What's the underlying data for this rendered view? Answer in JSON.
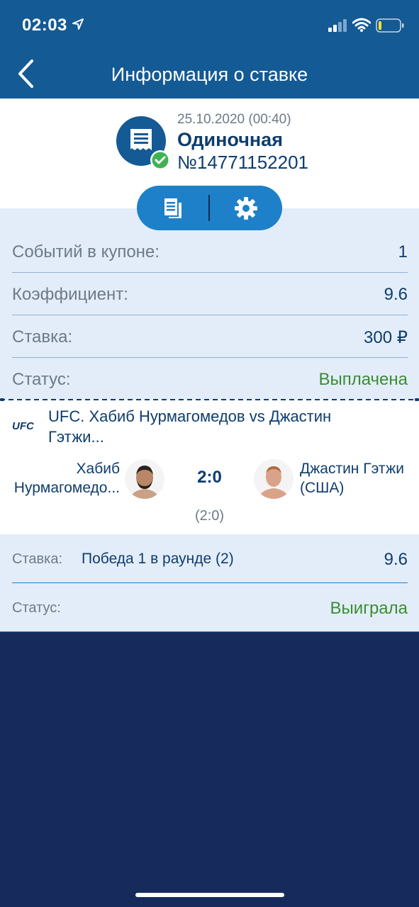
{
  "status_bar": {
    "time": "02:03"
  },
  "navbar": {
    "title": "Информация о ставке"
  },
  "bet": {
    "date": "25.10.2020 (00:40)",
    "type": "Одиночная",
    "number": "№14771152201"
  },
  "summary": [
    {
      "label": "Событий в купоне:",
      "value": "1"
    },
    {
      "label": "Коэффициент:",
      "value": "9.6"
    },
    {
      "label": "Ставка:",
      "value": "300 ₽"
    },
    {
      "label": "Статус:",
      "value": "Выплачена"
    }
  ],
  "event": {
    "logo_text": "UFC",
    "title": "UFC. Хабиб Нурмагомедов vs Джастин Гэтжи...",
    "team1": {
      "line1": "Хабиб",
      "line2": "Нурмагомедо..."
    },
    "team2": {
      "line1": "Джастин Гэтжи",
      "line2": "(США)"
    },
    "score": "2:0",
    "sub_score": "(2:0)"
  },
  "detail": {
    "bet_label": "Ставка:",
    "selection": "Победа 1 в раунде (2)",
    "odds": "9.6",
    "status_label": "Статус:",
    "status_value": "Выиграла"
  },
  "colors": {
    "header_blue": "#145a94",
    "accent_blue": "#1e80c8",
    "dark_navy": "#162a5c",
    "win_green": "#3b8c32",
    "text_navy": "#0e3d6e"
  },
  "icons": [
    "location-arrow-icon",
    "signal-icon",
    "wifi-icon",
    "battery-icon",
    "back-icon",
    "coupon-icon",
    "check-badge-icon",
    "document-icon",
    "gear-icon",
    "ufc-logo"
  ]
}
